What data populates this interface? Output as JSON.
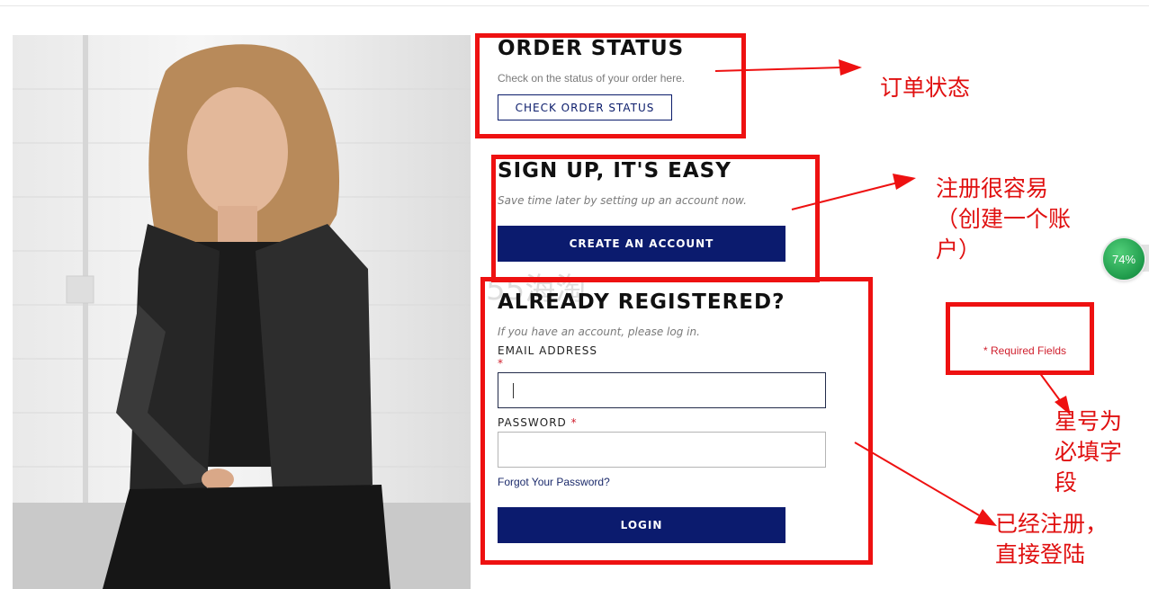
{
  "order_status": {
    "title": "ORDER STATUS",
    "subtitle": "Check on the status of your order here.",
    "button": "CHECK ORDER STATUS"
  },
  "signup": {
    "title": "SIGN UP, IT'S EASY",
    "subtitle": "Save time later by setting up an account now.",
    "button": "CREATE AN ACCOUNT"
  },
  "login": {
    "title": "ALREADY REGISTERED?",
    "subtitle": "If you have an account, please log in.",
    "email_label": "EMAIL ADDRESS",
    "required_mark": "*",
    "email_value": "",
    "password_label": "PASSWORD",
    "password_value": "",
    "forgot_link": "Forgot Your Password?",
    "button": "LOGIN",
    "required_fields_note": "* Required Fields"
  },
  "annotations": {
    "order_status": "订单状态",
    "signup_line1": "注册很容易",
    "signup_line2": "（创建一个账",
    "signup_line3": "户）",
    "required_line1": "星号为",
    "required_line2": "必填字",
    "required_line3": "段",
    "login_line1": "已经注册，",
    "login_line2": "直接登陆"
  },
  "watermark": "55海淘",
  "progress_badge": "74%",
  "colors": {
    "navy": "#0b1b6e",
    "annotation_red": "#ee1111",
    "required_red": "#d0202e",
    "badge_green": "#1e9a4a"
  }
}
